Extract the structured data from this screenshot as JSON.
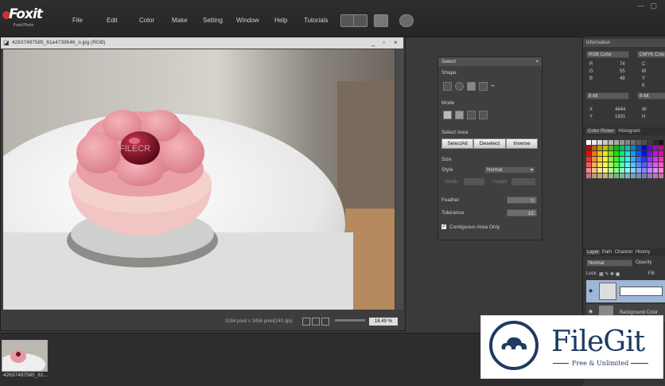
{
  "app": {
    "logo_main": "Foxit",
    "logo_sub": "Foxit Photo"
  },
  "menu": [
    "File",
    "Edit",
    "Color",
    "Make",
    "Setting",
    "Window",
    "Help",
    "Tutorials"
  ],
  "document": {
    "title": "42637497585_61e4739546_o.jpg (RGB)",
    "status": "3184 pixel x 3456 pixel(240 dpi)",
    "zoom": "16.49 %",
    "watermark": "FILECR"
  },
  "select_panel": {
    "title": "Select",
    "shape_label": "Shape",
    "mode_label": "Mode",
    "select_area_label": "Select Area",
    "buttons": [
      "SelectAll",
      "Deselect",
      "Inverse"
    ],
    "size_label": "Size",
    "style_label": "Style",
    "style_value": "Normal",
    "width_label": "Width",
    "height_label": "Height",
    "feather_label": "Feather",
    "feather_value": "0",
    "tolerance_label": "Tolerance",
    "tolerance_value": "15",
    "contiguous_label": "Contiguous Area Only",
    "contiguous_checked": true
  },
  "info_panel": {
    "title": "Information",
    "left_mode": "RGB Color",
    "right_mode": "CMYK Colo",
    "rgb": [
      [
        "R",
        "74"
      ],
      [
        "G",
        "55"
      ],
      [
        "B",
        "48"
      ]
    ],
    "cmyk": [
      "C",
      "M",
      "Y",
      "K"
    ],
    "bit_left": "8-bit",
    "bit_right": "8-bit",
    "coords": [
      [
        "X",
        "4644"
      ],
      [
        "Y",
        "1831"
      ]
    ],
    "coord_right": [
      "W",
      "H"
    ]
  },
  "color_tabs": [
    "Color Picker",
    "Histogram"
  ],
  "layer_panel": {
    "tabs": [
      "Layer",
      "Path",
      "Channel",
      "History"
    ],
    "blend": "Normal",
    "opacity_label": "Opacity",
    "lock_label": "Lock",
    "fill_label": "Fill",
    "layers": [
      "",
      "Background Color"
    ]
  },
  "thumbnail": {
    "label": "42637497585_61..."
  },
  "badge": {
    "name": "FileGit",
    "tagline": "Free & Unlimited"
  },
  "colors": {
    "accent": "#1f3a61",
    "layer_sel": "#9fb7d6"
  }
}
